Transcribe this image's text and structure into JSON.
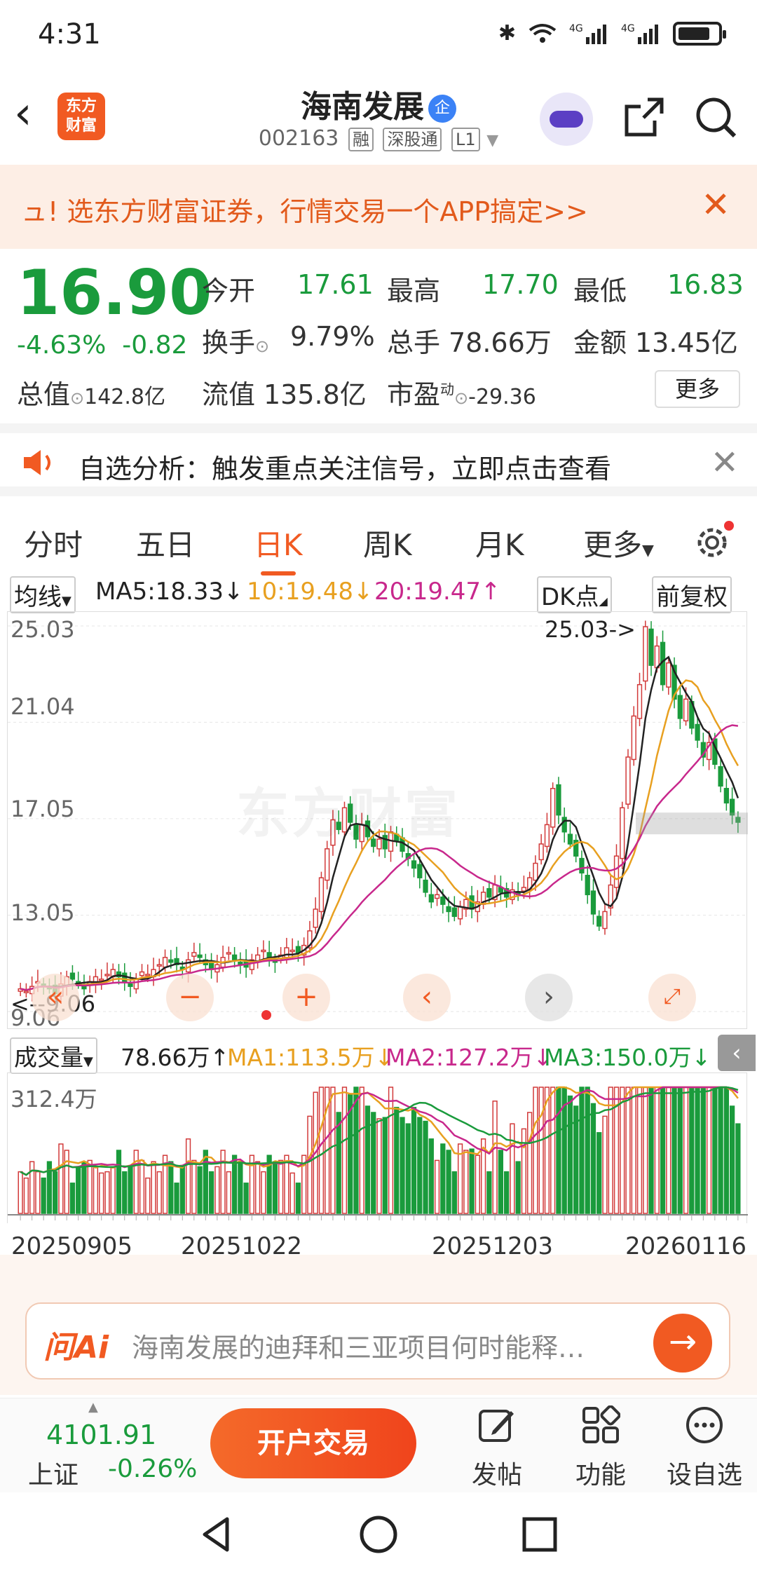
{
  "status": {
    "time": "4:31"
  },
  "header": {
    "title": "海南发展",
    "badge": "企",
    "code": "002163",
    "tags": [
      "融",
      "深股通",
      "L1"
    ],
    "logo_lines": [
      "东方",
      "财富"
    ]
  },
  "banner": {
    "text": "ュ! 选东方财富证券，行情交易一个APP搞定>>"
  },
  "quote": {
    "price": "16.90",
    "change_pct": "-4.63%",
    "change_abs": "-0.82",
    "open_label": "今开",
    "open": "17.61",
    "high_label": "最高",
    "high": "17.70",
    "low_label": "最低",
    "low": "16.83",
    "turnover_label": "换手",
    "turnover": "9.79%",
    "volume_label": "总手",
    "volume": "78.66万",
    "amount_label": "金额",
    "amount": "13.45亿",
    "mktcap_label": "总值",
    "mktcap": "142.8亿",
    "float_label": "流值",
    "float": "135.8亿",
    "pe_label": "市盈",
    "pe_sup": "动",
    "pe": "-29.36",
    "more": "更多"
  },
  "notice": {
    "text": "自选分析：触发重点关注信号，立即点击查看"
  },
  "tabs": [
    "分时",
    "五日",
    "日K",
    "周K",
    "月K",
    "更多"
  ],
  "active_tab": "日K",
  "ma": {
    "selector": "均线",
    "ma5": "MA5:18.33↓",
    "ma10": "10:19.48↓",
    "ma20": "20:19.47↑",
    "dk": "DK点",
    "adjust": "前复权",
    "colors": {
      "ma5": "#222222",
      "ma10": "#e8a020",
      "ma20": "#c8288c"
    }
  },
  "chart_data": {
    "type": "candlestick",
    "y_ticks": [
      "25.03",
      "21.04",
      "17.05",
      "13.05",
      "9.06"
    ],
    "ylim": [
      9.06,
      25.03
    ],
    "max_marker": "25.03->",
    "min_marker": "<--9.06",
    "watermark": "东方财富",
    "x_ticks": [
      "20250905",
      "20251022",
      "20251203",
      "20260116"
    ],
    "close": [
      10.0,
      9.9,
      10.1,
      10.3,
      10.2,
      10.0,
      9.8,
      10.2,
      10.5,
      10.4,
      10.2,
      10.0,
      10.3,
      10.5,
      10.4,
      10.6,
      10.8,
      10.5,
      10.3,
      10.1,
      10.4,
      10.7,
      10.6,
      10.8,
      11.0,
      11.3,
      11.1,
      11.0,
      10.8,
      11.2,
      11.5,
      11.3,
      11.0,
      10.8,
      11.0,
      11.3,
      11.5,
      11.2,
      11.0,
      10.9,
      11.2,
      11.4,
      11.6,
      11.3,
      11.1,
      11.4,
      11.7,
      11.6,
      11.5,
      11.8,
      12.4,
      13.3,
      14.6,
      15.8,
      17.0,
      16.6,
      17.5,
      16.9,
      16.2,
      16.8,
      16.3,
      15.9,
      16.2,
      15.8,
      16.5,
      16.1,
      15.7,
      15.4,
      15.0,
      14.6,
      14.0,
      13.6,
      13.9,
      13.5,
      13.2,
      13.0,
      13.4,
      13.7,
      13.3,
      13.6,
      14.0,
      13.8,
      14.3,
      14.0,
      13.8,
      14.1,
      13.9,
      14.2,
      14.6,
      15.2,
      16.0,
      16.8,
      18.3,
      17.2,
      16.5,
      16.0,
      15.5,
      14.8,
      13.9,
      13.1,
      12.6,
      13.2,
      14.3,
      15.5,
      17.5,
      19.6,
      21.3,
      22.6,
      25.0,
      23.4,
      24.2,
      22.6,
      23.5,
      22.0,
      21.2,
      22.0,
      20.8,
      20.3,
      19.6,
      20.2,
      19.3,
      18.4,
      17.7,
      17.2,
      16.9
    ],
    "volume_y_max": "312.4万"
  },
  "volume": {
    "selector": "成交量",
    "current": "78.66万↑",
    "ma1": "MA1:113.5万↓",
    "ma2": "MA2:127.2万↓",
    "ma3": "MA3:150.0万↓"
  },
  "ai": {
    "logo": "问Ai",
    "placeholder": "海南发展的迪拜和三亚项目何时能释…"
  },
  "bottom": {
    "index_value": "4101.91",
    "index_name": "上证",
    "index_change": "-0.26%",
    "open_account": "开户交易",
    "nav": [
      "发帖",
      "功能",
      "设自选"
    ]
  }
}
